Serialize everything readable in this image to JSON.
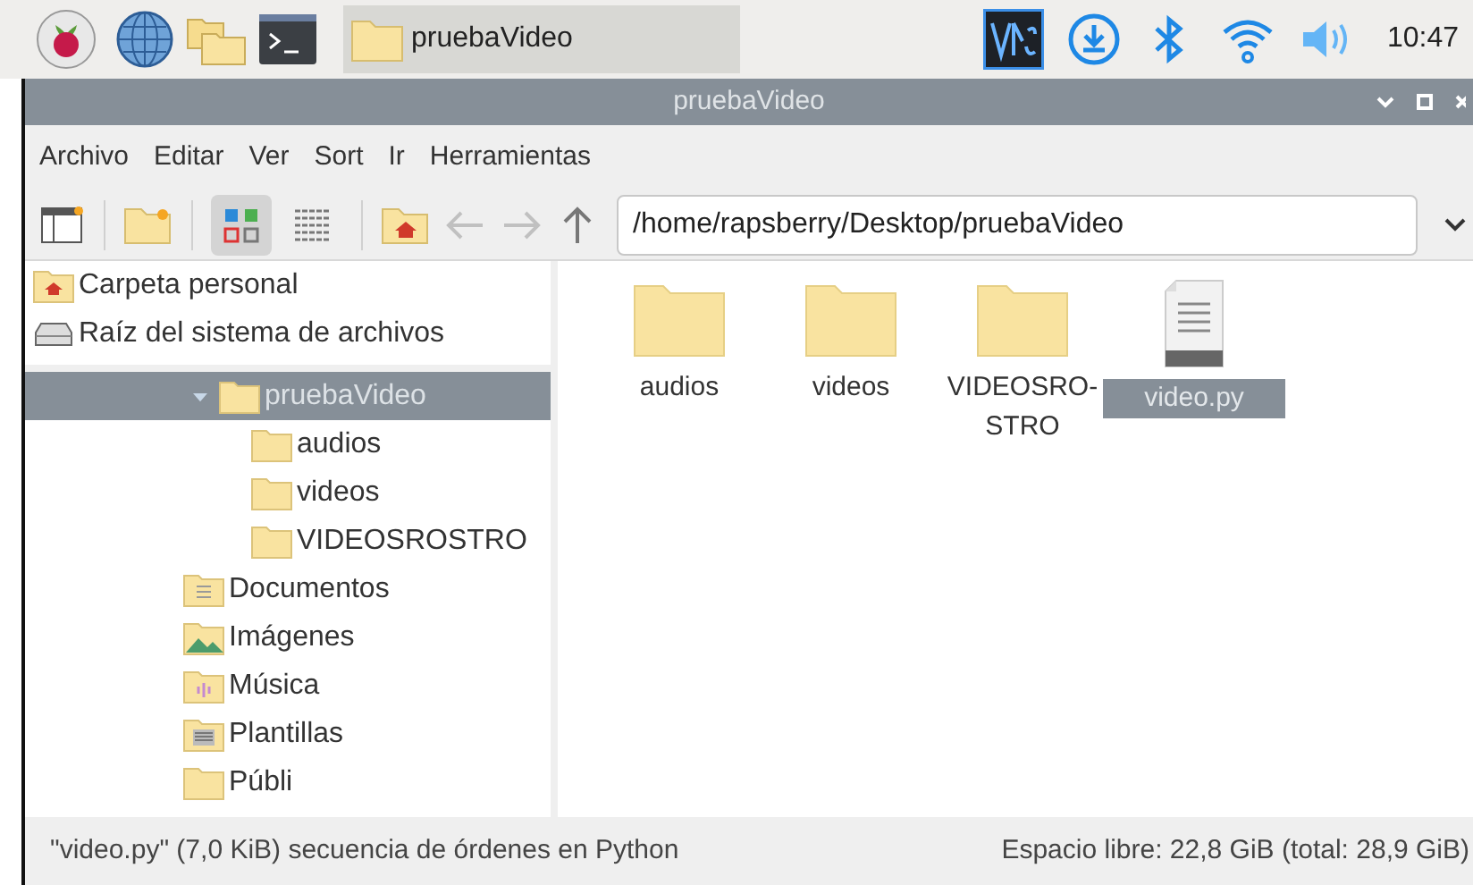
{
  "taskbar": {
    "task": {
      "label": "pruebaVideo",
      "selected": true
    },
    "clock": "10:47"
  },
  "window": {
    "title": "pruebaVideo"
  },
  "menu": [
    "Archivo",
    "Editar",
    "Ver",
    "Sort",
    "Ir",
    "Herramientas"
  ],
  "toolbar": {
    "view_buttons": [
      {
        "kind": "icons",
        "selected": true
      },
      {
        "kind": "list",
        "selected": false
      }
    ],
    "path": "/home/rapsberry/Desktop/pruebaVideo"
  },
  "places": [
    {
      "label": "Carpeta personal",
      "kind": "home"
    },
    {
      "label": "Raíz del sistema de archivos",
      "kind": "drive"
    }
  ],
  "tree": [
    {
      "label": "pruebaVideo",
      "kind": "folder",
      "expanded": true,
      "selected": true,
      "children": [
        {
          "label": "audios",
          "kind": "folder",
          "selected": false
        },
        {
          "label": "videos",
          "kind": "folder",
          "selected": false
        },
        {
          "label": "VIDEOSROSTRO",
          "kind": "folder",
          "selected": false
        }
      ]
    },
    {
      "label": "Documentos",
      "kind": "documents",
      "selected": false
    },
    {
      "label": "Imágenes",
      "kind": "pictures",
      "selected": false
    },
    {
      "label": "Música",
      "kind": "music",
      "selected": false
    },
    {
      "label": "Plantillas",
      "kind": "templates",
      "selected": false
    },
    {
      "label": "Públi",
      "kind": "folder",
      "selected": false
    }
  ],
  "files": [
    {
      "name": "audios",
      "kind": "folder",
      "selected": false
    },
    {
      "name": "videos",
      "kind": "folder",
      "selected": false
    },
    {
      "name": "VIDEOSRO-\nSTRO",
      "kind": "folder",
      "selected": false
    },
    {
      "name": "video.py",
      "kind": "file",
      "selected": true
    }
  ],
  "status_bar": {
    "left": "\"video.py\" (7,0 KiB) secuencia de órdenes en Python",
    "right": "Espacio libre: 22,8 GiB (total: 28,9 GiB)"
  }
}
